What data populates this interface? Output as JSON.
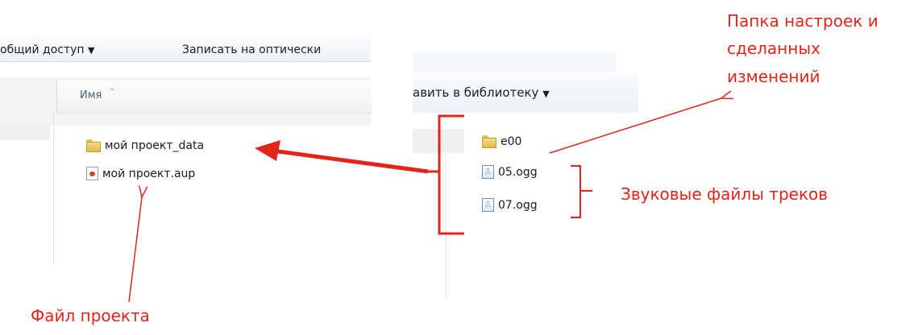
{
  "left_window": {
    "toolbar": {
      "share_label": "общий доступ",
      "share_arrow": "▼",
      "burn_label": "Записать на оптически"
    },
    "column_header": {
      "name_label": "Имя",
      "sort_arrow": "^"
    },
    "files": [
      {
        "name": "мой проект_data",
        "icon": "folder-icon"
      },
      {
        "name": "мой проект.aup",
        "icon": "audacity-project-icon"
      }
    ]
  },
  "right_window": {
    "toolbar": {
      "add_library_label": "авить в библиотеку",
      "add_library_arrow": "▼"
    },
    "files": [
      {
        "name": "e00",
        "icon": "folder-icon"
      },
      {
        "name": "05.ogg",
        "icon": "ogg-file-icon"
      },
      {
        "name": "07.ogg",
        "icon": "ogg-file-icon"
      }
    ]
  },
  "annotations": {
    "settings_folder_line1": "Папка настроек и",
    "settings_folder_line2": "сделанных",
    "settings_folder_line3": "изменений",
    "audio_files": "Звуковые файлы треков",
    "project_file": "Файл проекта"
  },
  "colors": {
    "annotation": "#e3241b",
    "folder": "#e2b94a"
  }
}
